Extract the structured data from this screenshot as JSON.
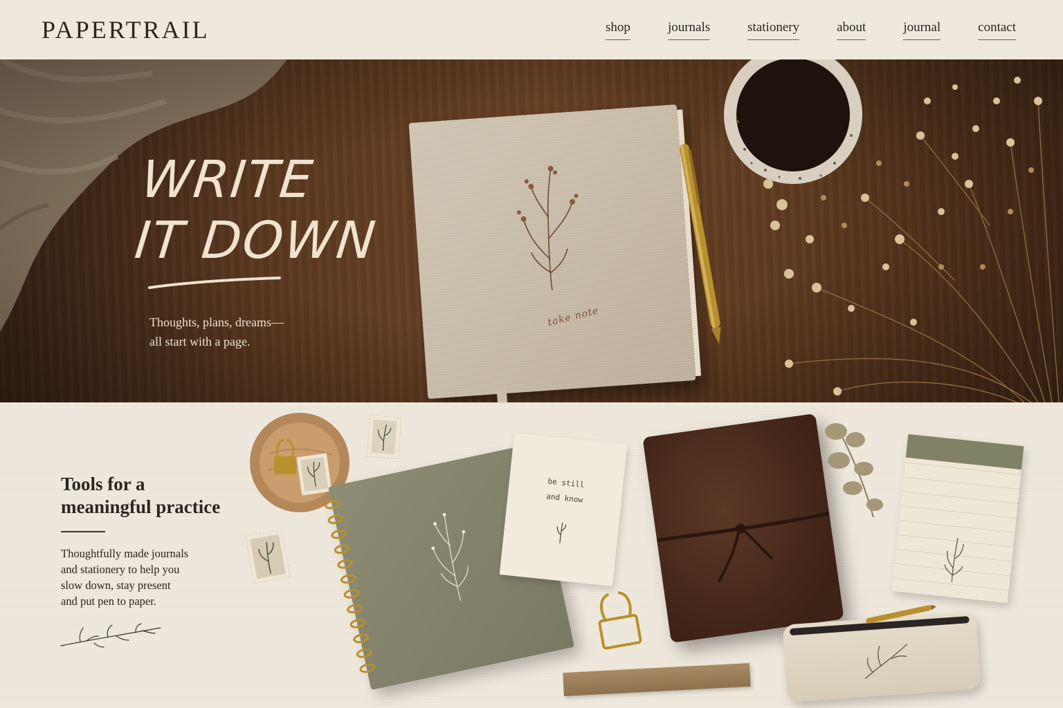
{
  "header": {
    "brand": "PAPERTRAIL",
    "nav": [
      "shop",
      "journals",
      "stationery",
      "about",
      "journal",
      "contact"
    ]
  },
  "hero": {
    "title_lines": [
      "WRITE",
      "IT DOWN"
    ],
    "subtitle_lines": [
      "Thoughts, plans, dreams—",
      "all start with a page."
    ],
    "notebook_label": "take note"
  },
  "feature": {
    "title_lines": [
      "Tools for a",
      "meaningful practice"
    ],
    "body_lines": [
      "Thoughtfully made journals",
      "and stationery to help you",
      "slow down, stay present",
      "and put pen to paper."
    ],
    "card_lines": [
      "be still",
      "and know"
    ]
  },
  "icons": [
    "floral-sprig-icon",
    "pen-icon",
    "coffee-cup-icon",
    "dried-flowers-icon",
    "binder-clip-icon",
    "postage-stamp-icon",
    "leaf-icon"
  ],
  "colors": {
    "background": "#efe8dc",
    "text": "#2c2520",
    "wood": "#5a3820",
    "hero_text": "#efe3cf",
    "sage": "#7a7963",
    "leather": "#3d2216",
    "gold": "#b8902e"
  }
}
